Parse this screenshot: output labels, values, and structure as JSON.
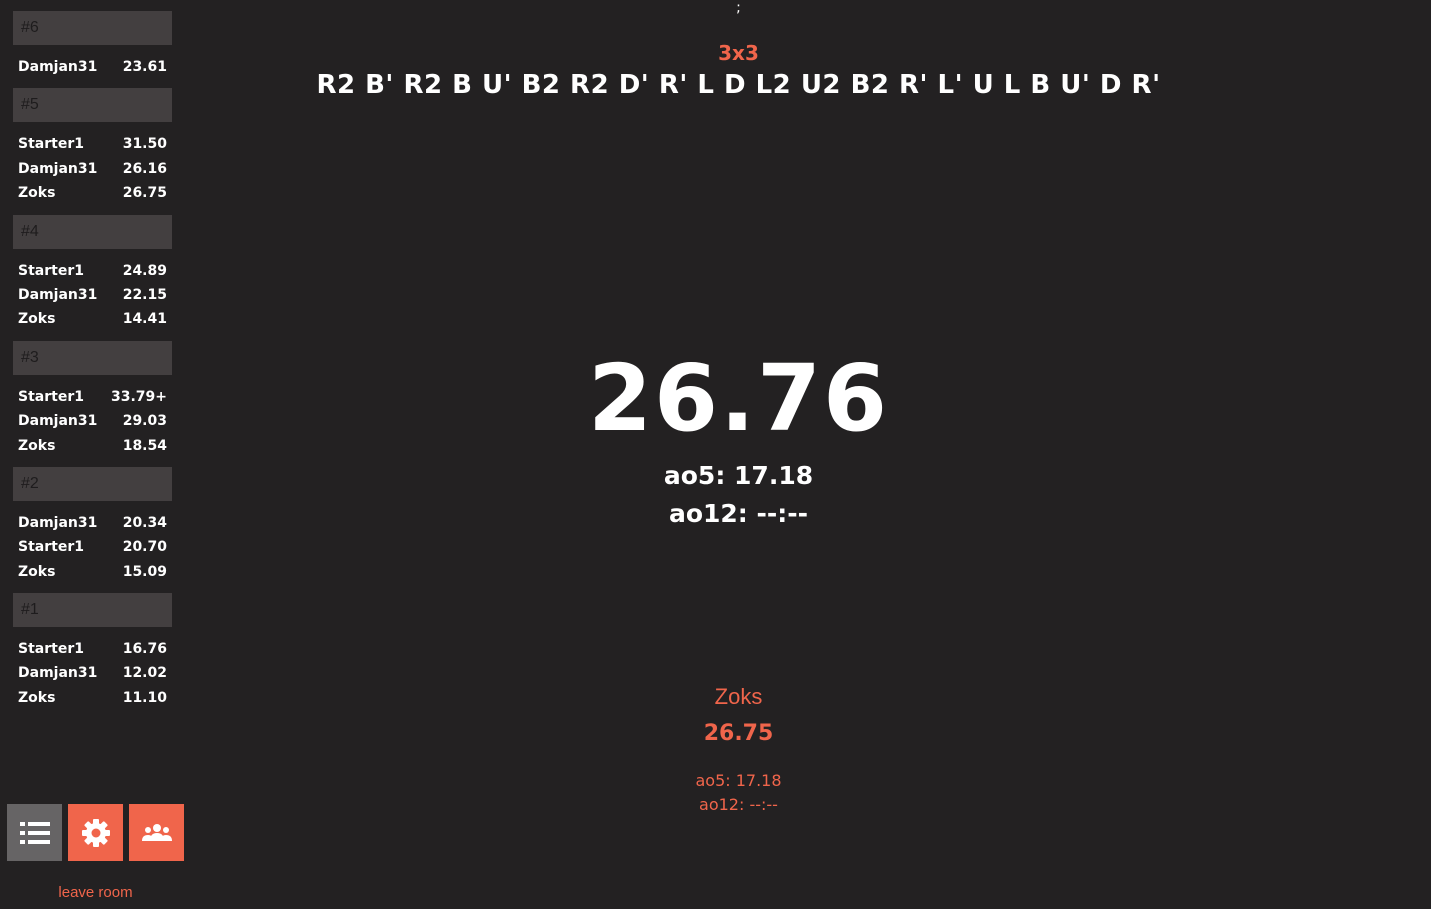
{
  "sidebar": {
    "rounds": [
      {
        "label": "#6",
        "results": [
          {
            "name": "Damjan31",
            "time": "23.61"
          }
        ]
      },
      {
        "label": "#5",
        "results": [
          {
            "name": "Starter1",
            "time": "31.50"
          },
          {
            "name": "Damjan31",
            "time": "26.16"
          },
          {
            "name": "Zoks",
            "time": "26.75"
          }
        ]
      },
      {
        "label": "#4",
        "results": [
          {
            "name": "Starter1",
            "time": "24.89"
          },
          {
            "name": "Damjan31",
            "time": "22.15"
          },
          {
            "name": "Zoks",
            "time": "14.41"
          }
        ]
      },
      {
        "label": "#3",
        "results": [
          {
            "name": "Starter1",
            "time": "33.79+"
          },
          {
            "name": "Damjan31",
            "time": "29.03"
          },
          {
            "name": "Zoks",
            "time": "18.54"
          }
        ]
      },
      {
        "label": "#2",
        "results": [
          {
            "name": "Damjan31",
            "time": "20.34"
          },
          {
            "name": "Starter1",
            "time": "20.70"
          },
          {
            "name": "Zoks",
            "time": "15.09"
          }
        ]
      },
      {
        "label": "#1",
        "results": [
          {
            "name": "Starter1",
            "time": "16.76"
          },
          {
            "name": "Damjan31",
            "time": "12.02"
          },
          {
            "name": "Zoks",
            "time": "11.10"
          }
        ]
      }
    ]
  },
  "toolbar": {
    "list_icon": "list-icon",
    "settings_icon": "gear-icon",
    "users_icon": "users-icon",
    "leave_room_label": "leave room"
  },
  "main": {
    "separator": ";",
    "event": "3x3",
    "scramble": "R2 B' R2 B U' B2 R2 D' R' L D L2 U2 B2 R' L' U L B U' D R'",
    "timer": "26.76",
    "ao5": "ao5: 17.18",
    "ao12": "ao12: --:--"
  },
  "opponent": {
    "name": "Zoks",
    "time": "26.75",
    "ao5": "ao5: 17.18",
    "ao12": "ao12: --:--"
  },
  "colors": {
    "background": "#232122",
    "accent": "#f0654b",
    "round_header": "#433f40",
    "list_button": "#666465"
  }
}
